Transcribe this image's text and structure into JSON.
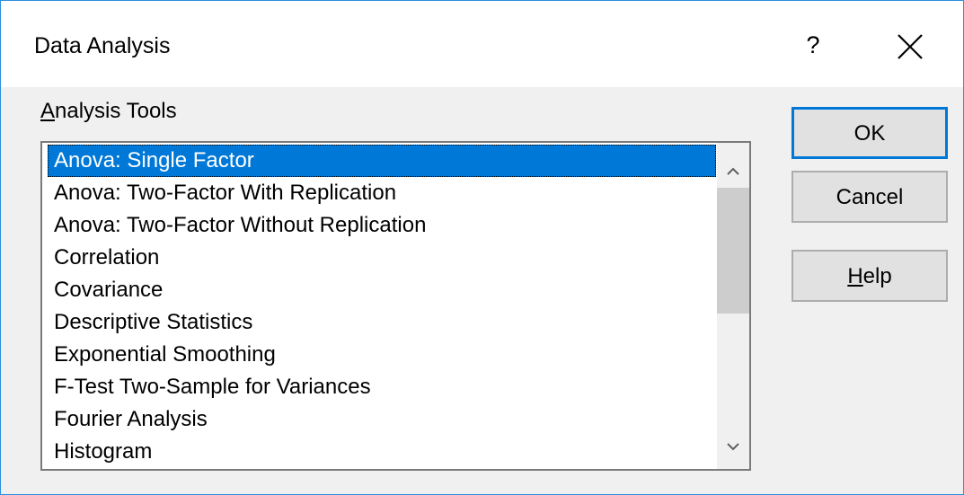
{
  "window": {
    "title": "Data Analysis",
    "help_glyph": "?",
    "close_icon": "close-icon"
  },
  "group_label": "Analysis Tools",
  "tools": [
    "Anova: Single Factor",
    "Anova: Two-Factor With Replication",
    "Anova: Two-Factor Without Replication",
    "Correlation",
    "Covariance",
    "Descriptive Statistics",
    "Exponential Smoothing",
    "F-Test Two-Sample for Variances",
    "Fourier Analysis",
    "Histogram"
  ],
  "selected_tool": "Anova: Single Factor",
  "buttons": {
    "ok": "OK",
    "cancel": "Cancel",
    "help": "Help"
  },
  "colors": {
    "selection": "#0078d7",
    "window_border": "#2b8fe0",
    "dialog_bg": "#f0f0f0"
  }
}
